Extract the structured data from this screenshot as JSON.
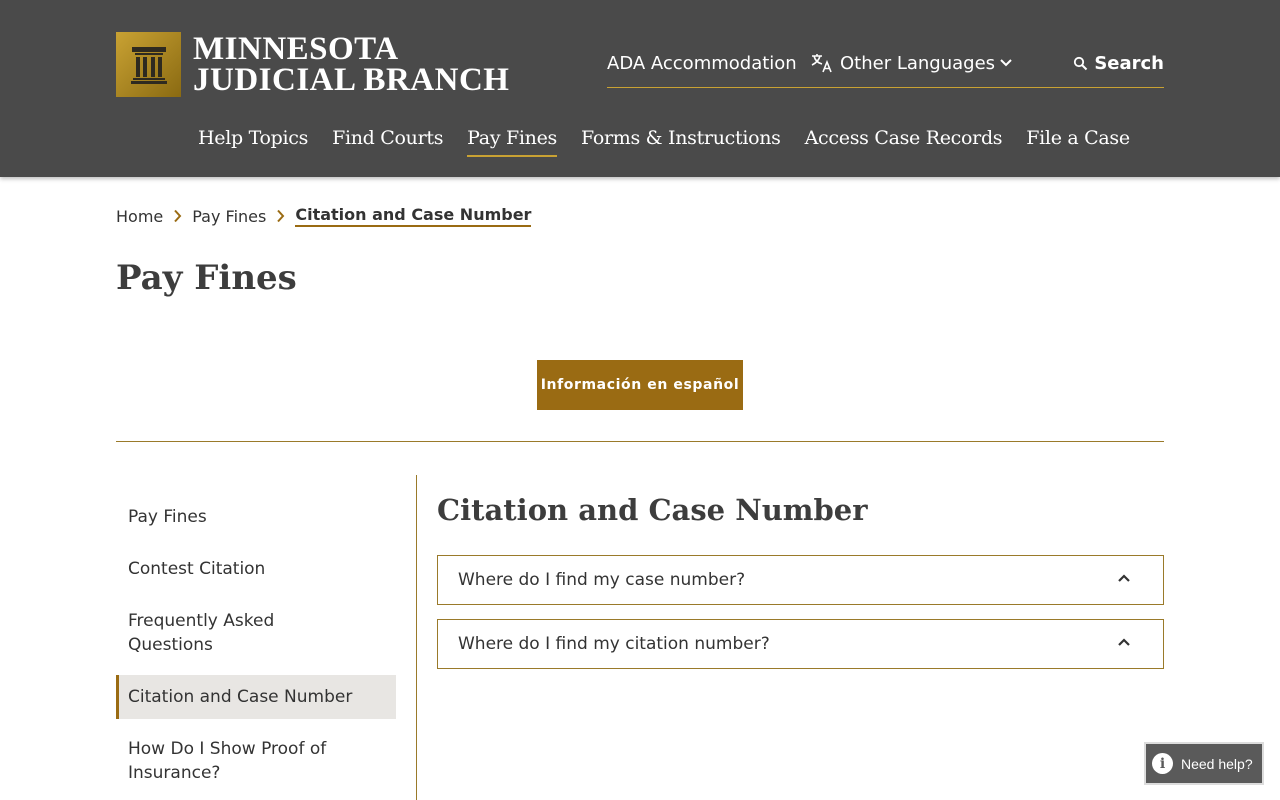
{
  "header": {
    "logo_line1": "MINNESOTA",
    "logo_line2": "JUDICIAL BRANCH",
    "utility": {
      "ada_label": "ADA Accommodation",
      "languages_label": "Other Languages",
      "search_label": "Search"
    },
    "nav": [
      {
        "label": "Help Topics"
      },
      {
        "label": "Find Courts"
      },
      {
        "label": "Pay Fines",
        "active": true
      },
      {
        "label": "Forms & Instructions"
      },
      {
        "label": "Access Case Records"
      },
      {
        "label": "File a Case"
      }
    ]
  },
  "breadcrumb": {
    "items": [
      "Home",
      "Pay Fines"
    ],
    "current": "Citation and Case Number"
  },
  "page_title": "Pay Fines",
  "spanish_button": "Información en español",
  "sidebar": {
    "items": [
      {
        "label": "Pay Fines"
      },
      {
        "label": "Contest Citation"
      },
      {
        "label": "Frequently Asked Questions"
      },
      {
        "label": "Citation and Case Number",
        "active": true
      },
      {
        "label": "How Do I Show Proof of Insurance?"
      }
    ]
  },
  "content": {
    "title": "Citation and Case Number",
    "accordions": [
      {
        "label": "Where do I find my case number?"
      },
      {
        "label": "Where do I find my citation number?"
      }
    ]
  },
  "help_widget": {
    "label": "Need help?"
  },
  "colors": {
    "header_bg": "#4a4a4a",
    "accent_gold": "#9a6b13",
    "logo_gold": "#c9a233"
  }
}
